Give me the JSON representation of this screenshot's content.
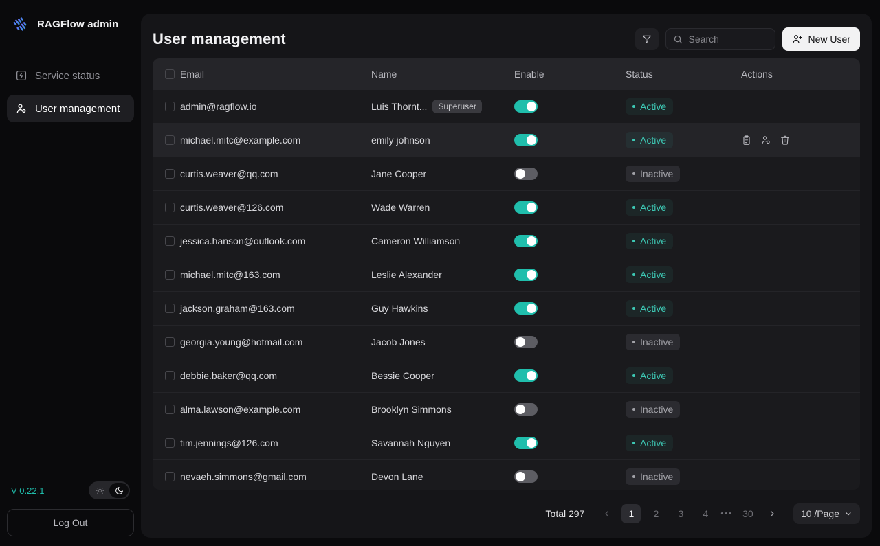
{
  "sidebar": {
    "brand": "RAGFlow admin",
    "items": [
      {
        "label": "Service status",
        "icon": "square-zap-icon",
        "active": false
      },
      {
        "label": "User management",
        "icon": "user-settings-icon",
        "active": true
      }
    ],
    "version": "V 0.22.1",
    "theme": {
      "selected": "dark",
      "icons": [
        "sun-icon",
        "moon-icon"
      ]
    },
    "logout_label": "Log Out"
  },
  "header": {
    "title": "User management",
    "filter_icon": "filter-icon",
    "search_placeholder": "Search",
    "new_user_label": "New User",
    "new_user_icon": "user-plus-icon"
  },
  "table": {
    "columns": [
      "Email",
      "Name",
      "Enable",
      "Status",
      "Actions"
    ],
    "action_icons": [
      "logs-icon",
      "user-settings-icon",
      "delete-icon"
    ],
    "rows": [
      {
        "email": "admin@ragflow.io",
        "name": "Luis Thornt...",
        "badge": "Superuser",
        "enabled": true,
        "status": "Active",
        "hover": false,
        "actions": false
      },
      {
        "email": "michael.mitc@example.com",
        "name": "emily johnson",
        "badge": null,
        "enabled": true,
        "status": "Active",
        "hover": true,
        "actions": true
      },
      {
        "email": "curtis.weaver@qq.com",
        "name": "Jane Cooper",
        "badge": null,
        "enabled": false,
        "status": "Inactive",
        "hover": false,
        "actions": false
      },
      {
        "email": "curtis.weaver@126.com",
        "name": "Wade Warren",
        "badge": null,
        "enabled": true,
        "status": "Active",
        "hover": false,
        "actions": false
      },
      {
        "email": "jessica.hanson@outlook.com",
        "name": "Cameron Williamson",
        "badge": null,
        "enabled": true,
        "status": "Active",
        "hover": false,
        "actions": false
      },
      {
        "email": "michael.mitc@163.com",
        "name": "Leslie Alexander",
        "badge": null,
        "enabled": true,
        "status": "Active",
        "hover": false,
        "actions": false
      },
      {
        "email": "jackson.graham@163.com",
        "name": "Guy Hawkins",
        "badge": null,
        "enabled": true,
        "status": "Active",
        "hover": false,
        "actions": false
      },
      {
        "email": "georgia.young@hotmail.com",
        "name": "Jacob Jones",
        "badge": null,
        "enabled": false,
        "status": "Inactive",
        "hover": false,
        "actions": false
      },
      {
        "email": "debbie.baker@qq.com",
        "name": "Bessie Cooper",
        "badge": null,
        "enabled": true,
        "status": "Active",
        "hover": false,
        "actions": false
      },
      {
        "email": "alma.lawson@example.com",
        "name": "Brooklyn Simmons",
        "badge": null,
        "enabled": false,
        "status": "Inactive",
        "hover": false,
        "actions": false
      },
      {
        "email": "tim.jennings@126.com",
        "name": "Savannah Nguyen",
        "badge": null,
        "enabled": true,
        "status": "Active",
        "hover": false,
        "actions": false
      },
      {
        "email": "nevaeh.simmons@gmail.com",
        "name": "Devon Lane",
        "badge": null,
        "enabled": false,
        "status": "Inactive",
        "hover": false,
        "actions": false
      }
    ]
  },
  "pagination": {
    "total_label": "Total 297",
    "pages": [
      "1",
      "2",
      "3",
      "4"
    ],
    "active_page": "1",
    "ellipsis": "•••",
    "last_page": "30",
    "page_size_label": "10 /Page"
  },
  "colors": {
    "accent": "#20beac",
    "active_status": "#3dc8b4",
    "card_background": "#151518",
    "sidebar_background": "#0a0a0c",
    "table_header_background": "#252529",
    "row_background": "#1a1a1d",
    "row_hover_background": "#242428"
  }
}
